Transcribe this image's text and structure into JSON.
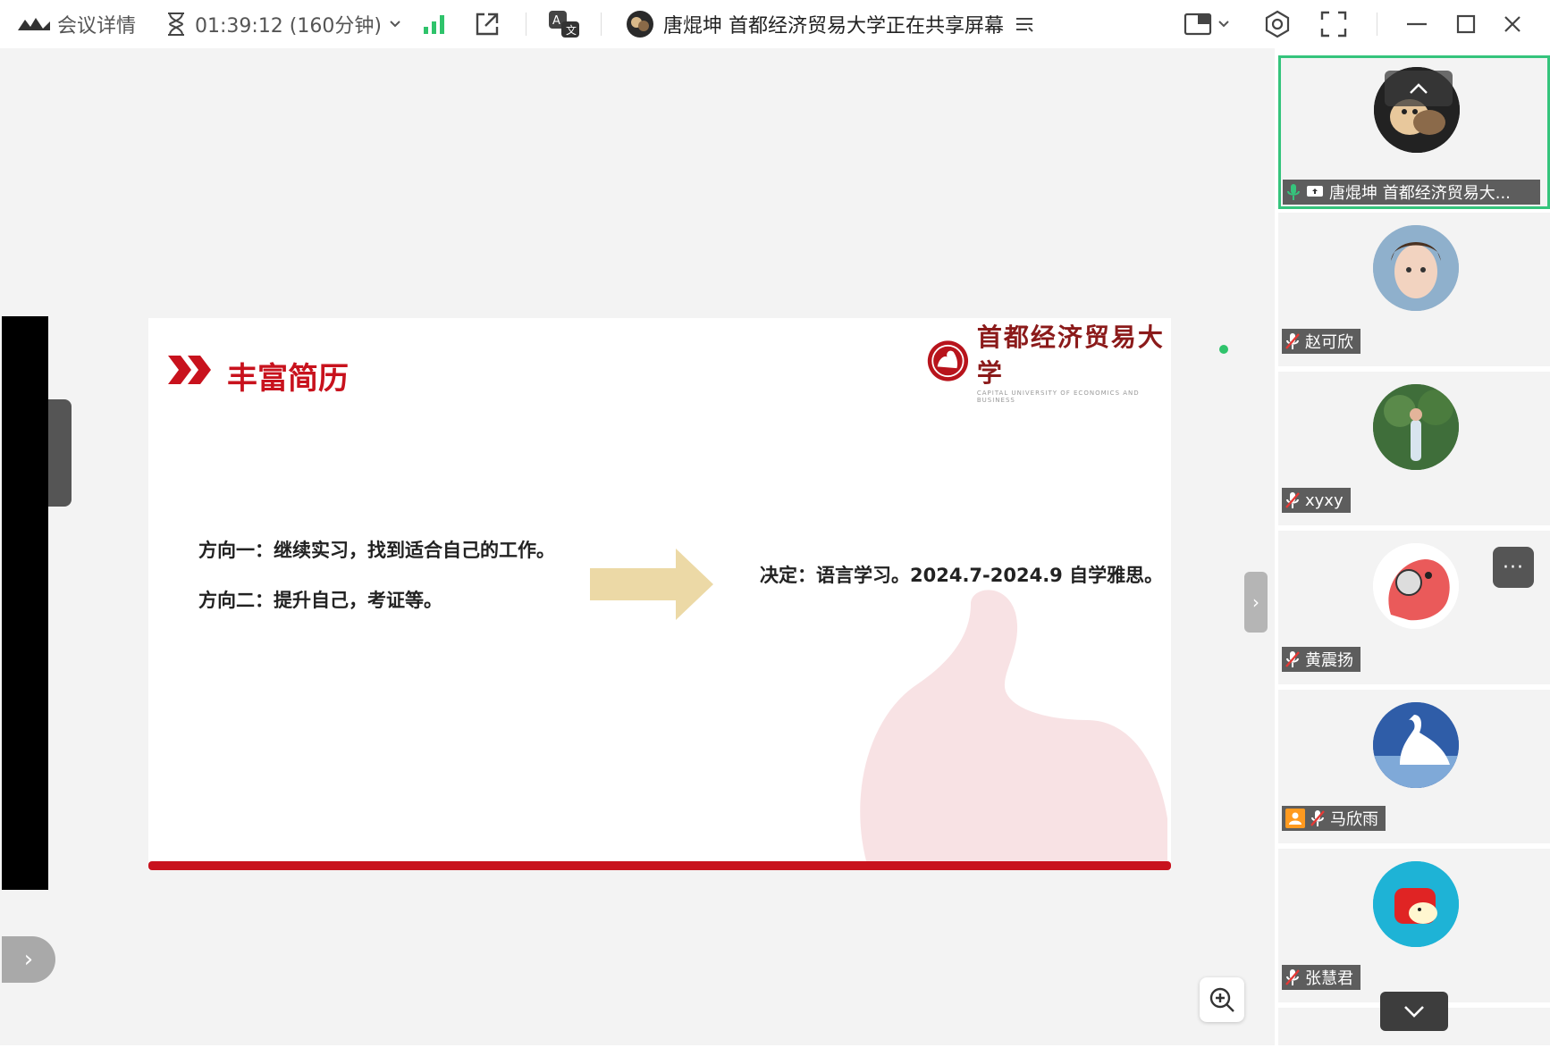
{
  "topbar": {
    "details_label": "会议详情",
    "duration": "01:39:12 (160分钟)",
    "sharer_text": "唐焜坤 首都经济贸易大学正在共享屏幕"
  },
  "slide": {
    "title": "丰富简历",
    "university_logo": "首都经济贸易大学",
    "university_subtitle": "CAPITAL UNIVERSITY OF ECONOMICS AND BUSINESS",
    "option1": "方向一：继续实习，找到适合自己的工作。",
    "option2": "方向二：提升自己，考证等。",
    "decision": "决定：语言学习。2024.7-2024.9 自学雅思。"
  },
  "participants": [
    {
      "name": "唐焜坤 首都经济贸易大...",
      "active": true,
      "sharing": true
    },
    {
      "name": "赵可欣"
    },
    {
      "name": "xyxy"
    },
    {
      "name": "黄震扬"
    },
    {
      "name": "马欣雨",
      "host": true
    },
    {
      "name": "张慧君"
    }
  ],
  "colors": {
    "accent_red": "#c8121d",
    "active_border": "#35c47c",
    "signal_green": "#2fc36b",
    "host_orange": "#ff9a1f"
  }
}
